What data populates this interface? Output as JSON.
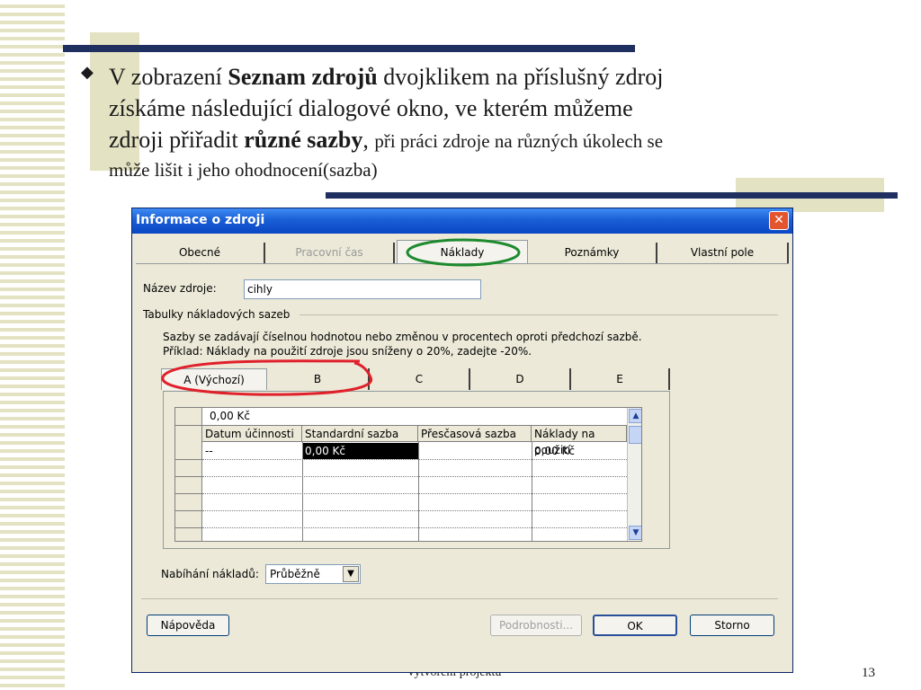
{
  "slide": {
    "bullet_line1_a": "V zobrazení ",
    "bullet_line1_b": "Seznam zdrojů",
    "bullet_line1_c": " dvojklikem na příslušný zdroj",
    "bullet_line2": "získáme následující dialogové okno, ve kterém můžeme",
    "bullet_line3_a": "zdroji přiřadit ",
    "bullet_line3_b": "různé sazby",
    "bullet_line3_c": ", ",
    "bullet_line3_d": "při práci zdroje na různých úkolech se",
    "bullet_line4": "může lišit i jeho ohodnocení(sazba)",
    "footer": "Vytvoření projektu",
    "page_number": "13",
    "colors": {
      "accent_bar": "#1f2f5f",
      "deco": "#e3e2c2",
      "annotation_green": "#1e8a2e",
      "annotation_red": "#e0202a"
    }
  },
  "dialog": {
    "title": "Informace o zdroji",
    "close_glyph": "✕",
    "tabs": [
      "Obecné",
      "Pracovní čas",
      "Náklady",
      "Poznámky",
      "Vlastní pole"
    ],
    "resource_name_label": "Název zdroje:",
    "resource_name_value": "cihly",
    "group_label": "Tabulky nákladových sazeb",
    "info_line1": "Sazby se zadávají číselnou hodnotou nebo změnou v procentech oproti předchozí sazbě.",
    "info_line2": "Příklad: Náklady na použití zdroje jsou sníženy o 20%, zadejte -20%.",
    "rate_tabs": [
      "A (Výchozí)",
      "B",
      "C",
      "D",
      "E"
    ],
    "edit_value": "0,00 Kč",
    "columns": [
      "Datum účinnosti",
      "Standardní sazba",
      "Přesčasová sazba",
      "Náklady na použití"
    ],
    "row1": [
      "--",
      "0,00 Kč",
      "",
      "0,00 Kč"
    ],
    "accrue_label": "Nabíhání nákladů:",
    "accrue_value": "Průběžně",
    "buttons": {
      "help": "Nápověda",
      "details": "Podrobnosti...",
      "ok": "OK",
      "cancel": "Storno"
    }
  }
}
